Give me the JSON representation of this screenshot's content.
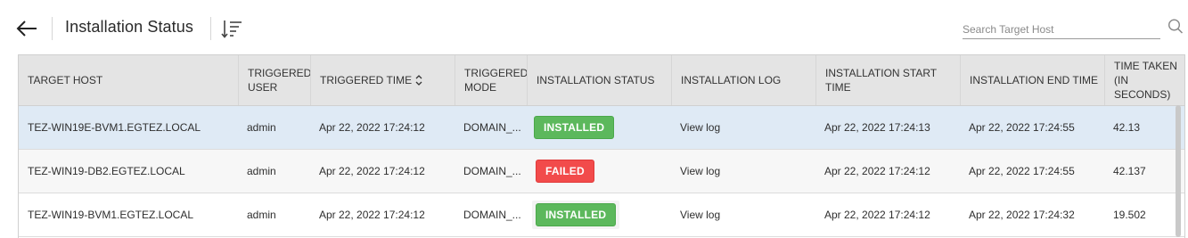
{
  "header": {
    "title": "Installation Status",
    "search_placeholder": "Search Target Host"
  },
  "icons": {
    "back": "arrow-left-icon",
    "sort": "sort-descending-icon",
    "search": "search-icon",
    "column_sort": "chevron-up-down-icon"
  },
  "colors": {
    "installed": "#5cb85c",
    "failed": "#f24b4b",
    "selected_row": "#dfeaf5",
    "header_bg": "#e4e4e4"
  },
  "table": {
    "columns": [
      "TARGET HOST",
      "TRIGGERED USER",
      "TRIGGERED TIME",
      "TRIGGERED MODE",
      "INSTALLATION STATUS",
      "INSTALLATION LOG",
      "INSTALLATION START TIME",
      "INSTALLATION END TIME",
      "TIME TAKEN (IN SECONDS)"
    ],
    "rows": [
      {
        "target_host": "TEZ-WIN19E-BVM1.EGTEZ.LOCAL",
        "user": "admin",
        "triggered_time": "Apr 22, 2022 17:24:12",
        "mode": "DOMAIN_...",
        "status": "INSTALLED",
        "log": "View log",
        "start_time": "Apr 22, 2022 17:24:13",
        "end_time": "Apr 22, 2022 17:24:55",
        "time_taken": "42.13"
      },
      {
        "target_host": "TEZ-WIN19-DB2.EGTEZ.LOCAL",
        "user": "admin",
        "triggered_time": "Apr 22, 2022 17:24:12",
        "mode": "DOMAIN_...",
        "status": "FAILED",
        "log": "View log",
        "start_time": "Apr 22, 2022 17:24:12",
        "end_time": "Apr 22, 2022 17:24:55",
        "time_taken": "42.137"
      },
      {
        "target_host": "TEZ-WIN19-BVM1.EGTEZ.LOCAL",
        "user": "admin",
        "triggered_time": "Apr 22, 2022 17:24:12",
        "mode": "DOMAIN_...",
        "status": "INSTALLED",
        "log": "View log",
        "start_time": "Apr 22, 2022 17:24:12",
        "end_time": "Apr 22, 2022 17:24:32",
        "time_taken": "19.502"
      }
    ]
  }
}
